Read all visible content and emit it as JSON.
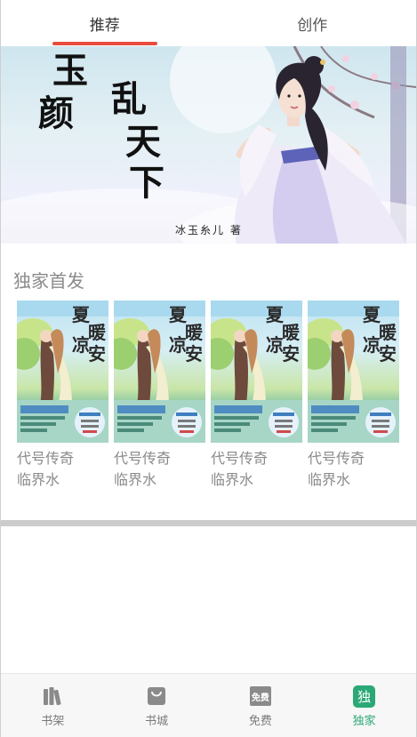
{
  "top_tabs": [
    {
      "label": "推荐",
      "active": true
    },
    {
      "label": "创作",
      "active": false
    }
  ],
  "accent_color": "#e84c3d",
  "banner": {
    "title_chars": [
      "玉",
      "颜",
      "乱",
      "天",
      "下"
    ],
    "author": "冰玉糸儿 著"
  },
  "section": {
    "title": "独家首发",
    "books": [
      {
        "title": "代号传奇",
        "author": "临界水",
        "cover_chars": [
          "夏",
          "暖",
          "凉",
          "安"
        ]
      },
      {
        "title": "代号传奇",
        "author": "临界水",
        "cover_chars": [
          "夏",
          "暖",
          "凉",
          "安"
        ]
      },
      {
        "title": "代号传奇",
        "author": "临界水",
        "cover_chars": [
          "夏",
          "暖",
          "凉",
          "安"
        ]
      },
      {
        "title": "代号传奇",
        "author": "临界水",
        "cover_chars": [
          "夏",
          "暖",
          "凉",
          "安"
        ]
      }
    ]
  },
  "bottom_nav": {
    "items": [
      {
        "label": "书架",
        "icon": "bookshelf-icon",
        "active": false
      },
      {
        "label": "书城",
        "icon": "shopping-bag-icon",
        "active": false
      },
      {
        "label": "免费",
        "icon": "free-badge-icon",
        "icon_text": "免费",
        "active": false
      },
      {
        "label": "独家",
        "icon": "exclusive-badge-icon",
        "icon_text": "独",
        "active": true
      }
    ],
    "active_color": "#2aa876"
  }
}
